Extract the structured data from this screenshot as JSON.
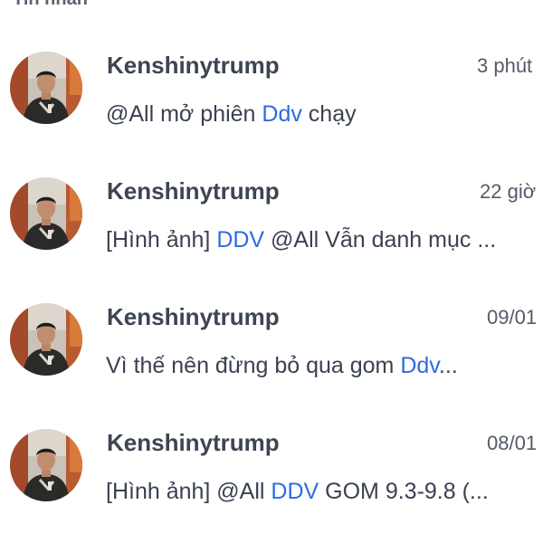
{
  "section": {
    "header_label": "Tin nhắn"
  },
  "colors": {
    "link": "#2d6cdf",
    "sender_text": "#3d4452",
    "body_text": "#3a4150",
    "time_text": "#545b68"
  },
  "messages": [
    {
      "sender": "Kenshinytrump",
      "time": "3 phút",
      "avatar_icon": "user-avatar",
      "preview_parts": [
        {
          "text": "@All mở phiên ",
          "link": false
        },
        {
          "text": "Ddv",
          "link": true
        },
        {
          "text": " chạy",
          "link": false
        }
      ]
    },
    {
      "sender": "Kenshinytrump",
      "time": "22 giờ",
      "avatar_icon": "user-avatar",
      "preview_parts": [
        {
          "text": "[Hình ảnh] ",
          "link": false
        },
        {
          "text": "DDV",
          "link": true
        },
        {
          "text": " @All Vẫn danh mục ...",
          "link": false
        }
      ]
    },
    {
      "sender": "Kenshinytrump",
      "time": "09/01",
      "avatar_icon": "user-avatar",
      "preview_parts": [
        {
          "text": "Vì thế nên đừng bỏ qua gom ",
          "link": false
        },
        {
          "text": "Ddv",
          "link": true
        },
        {
          "text": "...",
          "link": false
        }
      ]
    },
    {
      "sender": "Kenshinytrump",
      "time": "08/01",
      "avatar_icon": "user-avatar",
      "preview_parts": [
        {
          "text": "[Hình ảnh] @All ",
          "link": false
        },
        {
          "text": "DDV",
          "link": true
        },
        {
          "text": " GOM 9.3-9.8 (...",
          "link": false
        }
      ]
    }
  ]
}
